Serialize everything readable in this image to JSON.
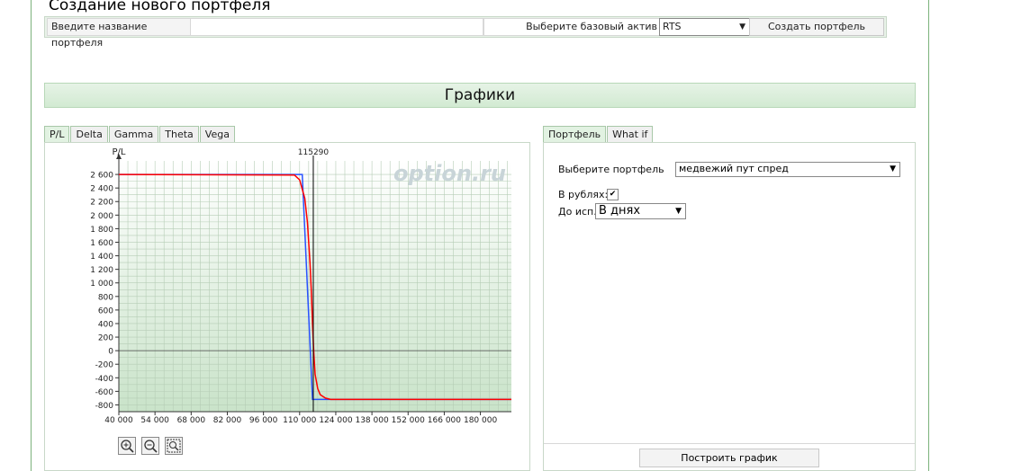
{
  "create": {
    "title": "Создание нового портфеля",
    "name_label": "Введите название портфеля",
    "name_value": "",
    "base_label": "Выберите базовый актив",
    "base_value": "RTS",
    "create_button": "Создать портфель"
  },
  "section": {
    "title": "Графики"
  },
  "chart_tabs": [
    "P/L",
    "Delta",
    "Gamma",
    "Theta",
    "Vega"
  ],
  "chart_tabs_active": "P/L",
  "right_tabs": [
    "Портфель",
    "What if"
  ],
  "right_tabs_active": "Портфель",
  "portfolio_panel": {
    "select_label": "Выберите портфель",
    "select_value": "медвежий пут спред",
    "rubles_label": "В рублях:",
    "rubles_checked": true,
    "expiry_label": "До исп.:",
    "expiry_value": "В днях",
    "build_button": "Построить график"
  },
  "watermark": "option.ru",
  "colors": {
    "accent_green": "#7cb27c",
    "line_red": "#ff0000",
    "line_blue": "#2a52ff",
    "marker_line": "#000000"
  },
  "chart_data": {
    "type": "line",
    "ylabel": "P/L",
    "xlabel": "",
    "marker_label": "115290",
    "marker_x": 115290,
    "xlim": [
      40000,
      192000
    ],
    "ylim": [
      -900,
      2800
    ],
    "x_ticks": [
      40000,
      54000,
      68000,
      82000,
      96000,
      110000,
      124000,
      138000,
      152000,
      166000,
      180000
    ],
    "x_tick_labels": [
      "40 000",
      "54 000",
      "68 000",
      "82 000",
      "96 000",
      "110 000",
      "124 000",
      "138 000",
      "152 000",
      "166 000",
      "180 000"
    ],
    "y_ticks": [
      2600,
      2400,
      2200,
      2000,
      1800,
      1600,
      1400,
      1200,
      1000,
      800,
      600,
      400,
      200,
      0,
      -200,
      -400,
      -600,
      -800
    ],
    "y_tick_labels": [
      "2 600",
      "2 400",
      "2 200",
      "2 000",
      "1 800",
      "1 600",
      "1 400",
      "1 200",
      "1 000",
      "800",
      "600",
      "400",
      "200",
      "0",
      "-200",
      "-400",
      "-600",
      "-800"
    ],
    "grid": true,
    "series": [
      {
        "color": "#2a52ff",
        "x": [
          40000,
          111000,
          115000,
          192000
        ],
        "y": [
          2600,
          2600,
          -720,
          -720
        ]
      },
      {
        "color": "#ff0000",
        "x": [
          40000,
          108000,
          110000,
          112000,
          113000,
          114000,
          114500,
          115000,
          115500,
          116000,
          117000,
          118000,
          120000,
          122000,
          192000
        ],
        "y": [
          2600,
          2590,
          2520,
          2250,
          1900,
          1300,
          900,
          400,
          -50,
          -350,
          -560,
          -650,
          -700,
          -720,
          -720
        ]
      }
    ]
  }
}
